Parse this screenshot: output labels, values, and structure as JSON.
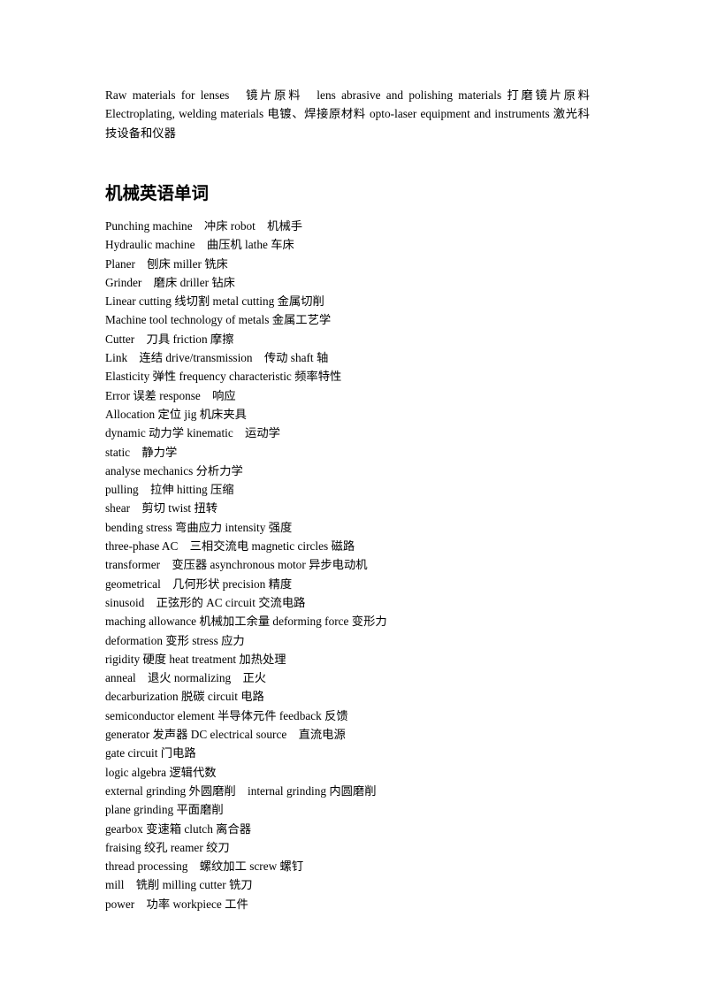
{
  "document": {
    "intro_paragraph": "Raw materials for lenses　镜片原料　lens abrasive and polishing materials 打磨镜片原料 Electroplating, welding materials 电镀、焊接原材料 opto-laser equipment and instruments 激光科技设备和仪器",
    "section_heading": "机械英语单词",
    "vocabulary": [
      "Punching machine　冲床 robot　机械手",
      "Hydraulic machine　曲压机 lathe 车床",
      "Planer　刨床 miller 铣床",
      "Grinder　磨床 driller 钻床",
      "Linear cutting 线切割 metal cutting 金属切削",
      "Machine tool technology of metals 金属工艺学",
      "Cutter　刀具 friction 摩擦",
      "Link　连结 drive/transmission　传动 shaft 轴",
      "Elasticity 弹性 frequency characteristic 频率特性",
      "Error 误差 response　响应",
      "Allocation 定位 jig 机床夹具",
      "dynamic 动力学 kinematic　运动学",
      "static　静力学",
      "analyse mechanics 分析力学",
      "pulling　拉伸 hitting 压缩",
      "shear　剪切 twist 扭转",
      "bending stress 弯曲应力 intensity 强度",
      "three-phase AC　三相交流电 magnetic circles 磁路",
      "transformer　变压器 asynchronous motor 异步电动机",
      "geometrical　几何形状 precision 精度",
      "sinusoid　正弦形的 AC circuit 交流电路",
      "maching allowance 机械加工余量 deforming force 变形力",
      "deformation 变形 stress 应力",
      "rigidity 硬度 heat treatment 加热处理",
      "anneal　退火 normalizing　正火",
      "decarburization 脱碳 circuit 电路",
      "semiconductor element 半导体元件 feedback 反馈",
      "generator 发声器 DC electrical source　直流电源",
      "gate circuit 门电路",
      "logic algebra 逻辑代数",
      "external grinding 外圆磨削　internal grinding 内圆磨削",
      "plane grinding 平面磨削",
      "gearbox 变速箱 clutch 离合器",
      "fraising 绞孔 reamer 绞刀",
      "thread processing　螺纹加工 screw 螺钉",
      "mill　铣削 milling cutter 铣刀",
      "power　功率 workpiece 工件"
    ]
  },
  "style": {
    "text_color": "#000000",
    "background_color": "#ffffff"
  }
}
